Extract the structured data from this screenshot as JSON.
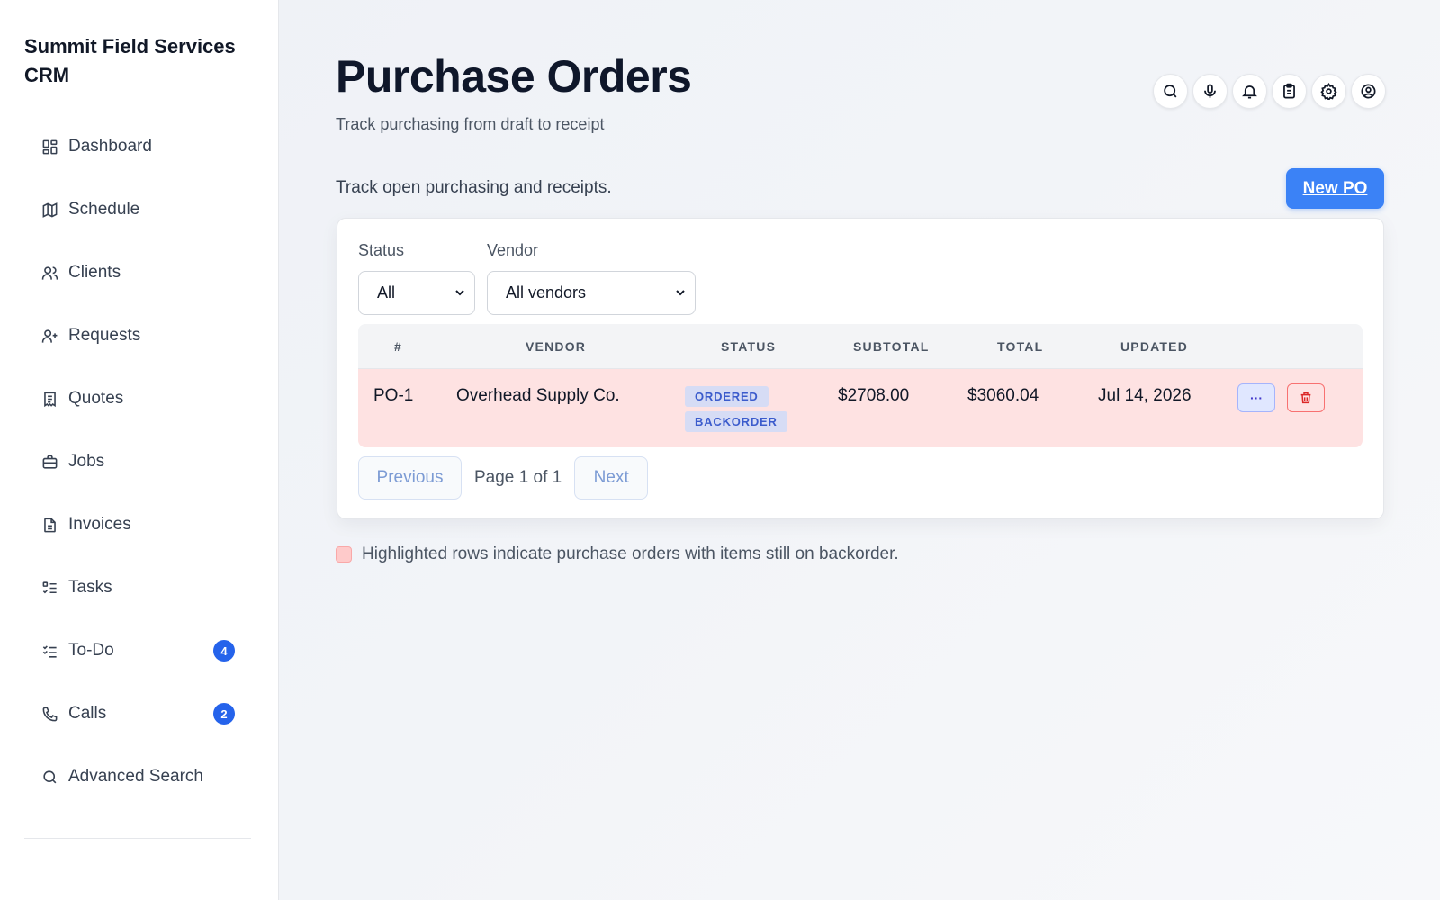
{
  "app": {
    "title": "Summit Field Services CRM"
  },
  "sidebar": {
    "items": [
      {
        "label": "Dashboard",
        "icon": "dashboard-icon"
      },
      {
        "label": "Schedule",
        "icon": "map-icon"
      },
      {
        "label": "Clients",
        "icon": "users-icon"
      },
      {
        "label": "Requests",
        "icon": "user-plus-icon"
      },
      {
        "label": "Quotes",
        "icon": "receipt-icon"
      },
      {
        "label": "Jobs",
        "icon": "briefcase-icon"
      },
      {
        "label": "Invoices",
        "icon": "file-text-icon"
      },
      {
        "label": "Tasks",
        "icon": "list-check-icon"
      },
      {
        "label": "To-Do",
        "icon": "checklist-icon",
        "badge": "4"
      },
      {
        "label": "Calls",
        "icon": "phone-icon",
        "badge": "2"
      },
      {
        "label": "Advanced Search",
        "icon": "search-icon"
      }
    ]
  },
  "header": {
    "title": "Purchase Orders",
    "subtitle": "Track purchasing from draft to receipt",
    "icons": [
      "search-icon",
      "microphone-icon",
      "bell-icon",
      "clipboard-icon",
      "gear-icon",
      "user-circle-icon"
    ]
  },
  "intro": "Track open purchasing and receipts.",
  "new_po_label": "New PO",
  "filters": {
    "status_label": "Status",
    "status_value": "All",
    "vendor_label": "Vendor",
    "vendor_value": "All vendors"
  },
  "table": {
    "columns": [
      "#",
      "Vendor",
      "Status",
      "Subtotal",
      "Total",
      "Updated"
    ],
    "rows": [
      {
        "id": "PO-1",
        "vendor": "Overhead Supply Co.",
        "statuses": [
          "ORDERED",
          "BACKORDER"
        ],
        "subtotal": "$2708.00",
        "total": "$3060.04",
        "updated": "Jul 14, 2026",
        "more_label": "···"
      }
    ]
  },
  "pager": {
    "previous": "Previous",
    "page_text": "Page 1 of 1",
    "next": "Next"
  },
  "legend": "Highlighted rows indicate purchase orders with items still on backorder.",
  "colors": {
    "accent": "#3b82f6",
    "badge": "#2563eb",
    "highlight_row": "#fee2e2"
  }
}
